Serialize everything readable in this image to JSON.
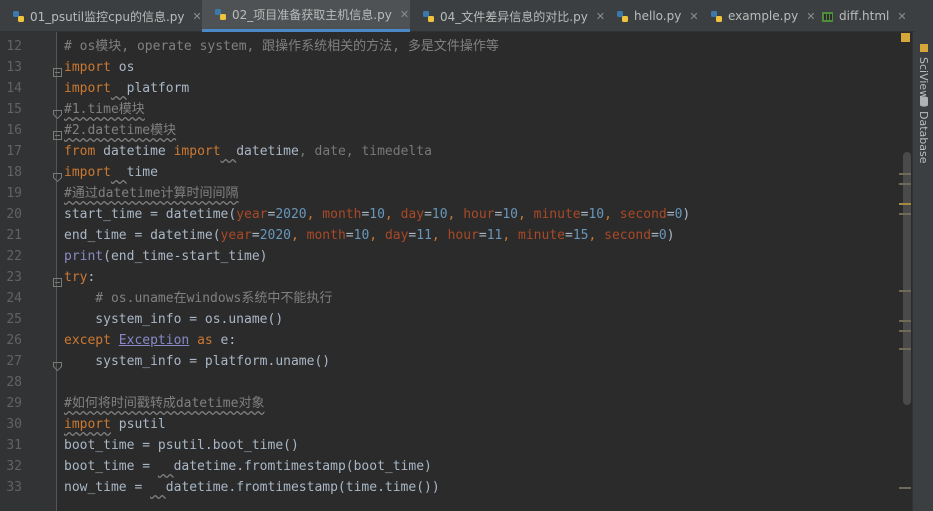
{
  "tabs": [
    {
      "label": "01_psutil监控cpu的信息.py",
      "icon": "python-file-icon"
    },
    {
      "label": "02_项目准备获取主机信息.py",
      "icon": "python-file-icon",
      "active": true
    },
    {
      "label": "04_文件差异信息的对比.py",
      "icon": "python-file-icon"
    },
    {
      "label": "hello.py",
      "icon": "python-file-icon"
    },
    {
      "label": "example.py",
      "icon": "python-file-icon"
    },
    {
      "label": "diff.html",
      "icon": "html-file-icon"
    }
  ],
  "line_numbers": [
    "12",
    "13",
    "14",
    "15",
    "16",
    "17",
    "18",
    "19",
    "20",
    "21",
    "22",
    "23",
    "24",
    "25",
    "26",
    "27",
    "28",
    "29",
    "30",
    "31",
    "32",
    "33"
  ],
  "code": {
    "l12": "# os模块, operate system, 跟操作系统相关的方法, 多是文件操作等",
    "l13_kw": "import",
    "l13_rest": " os",
    "l14_kw": "import",
    "l14_rest": "platform",
    "l15": "#1.time模块",
    "l16": "#2.datetime模块",
    "l17_from": "from",
    "l17_mod": " datetime ",
    "l17_kw": "import",
    "l17_a": "datetime",
    "l17_b": ", date, timedelta",
    "l18_kw": "import",
    "l18_rest": "time",
    "l19": "#通过datetime计算时间间隔",
    "l20_a": "start_time = datetime(",
    "l20_p1": "year",
    "l20_v1": "2020",
    "l20_p2": "month",
    "l20_v2": "10",
    "l20_p3": "day",
    "l20_v3": "10",
    "l20_p4": "hour",
    "l20_v4": "10",
    "l20_p5": "minute",
    "l20_v5": "10",
    "l20_p6": "second",
    "l20_v6": "0",
    "l21_a": "end_time = datetime(",
    "l21_p1": "year",
    "l21_v1": "2020",
    "l21_p2": "month",
    "l21_v2": "10",
    "l21_p3": "day",
    "l21_v3": "11",
    "l21_p4": "hour",
    "l21_v4": "11",
    "l21_p5": "minute",
    "l21_v5": "15",
    "l21_p6": "second",
    "l21_v6": "0",
    "l22_fn": "print",
    "l22_rest": "(end_time-start_time)",
    "l23_kw": "try",
    "l23_rest": ":",
    "l24": "    # os.uname在windows系统中不能执行",
    "l25": "    system_info = os.uname()",
    "l26_kw": "except",
    "l26_cls": "Exception",
    "l26_as": "as",
    "l26_rest": " e:",
    "l27": "    system_info = platform.uname()",
    "l28": "",
    "l29": "#如何将时间戳转成datetime对象",
    "l30_kw": "import",
    "l30_rest": " psutil",
    "l31": "boot_time = psutil.boot_time()",
    "l32_a": "boot_time = ",
    "l32_b": "datetime.fromtimestamp(boot_time)",
    "l33_a": "now_time = ",
    "l33_b": "datetime.fromtimestamp(time.time())"
  },
  "right_tools": [
    "SciView",
    "Database"
  ],
  "colors": {
    "keyword": "#cc7832",
    "comment": "#808080",
    "number": "#6897bb",
    "param": "#aa4926",
    "builtin": "#8888c6",
    "text": "#a9b7c6",
    "background": "#2b2b2b"
  }
}
